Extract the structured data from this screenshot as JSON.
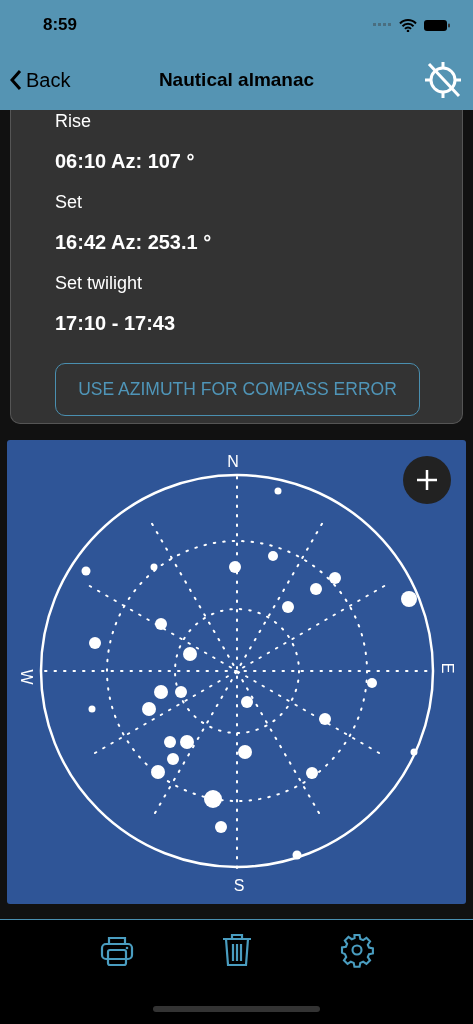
{
  "status_bar": {
    "time": "8:59"
  },
  "nav": {
    "back": "Back",
    "title": "Nautical almanac"
  },
  "events": [
    {
      "label": "Rise",
      "value": "06:10 Az: 107 °"
    },
    {
      "label": "Set",
      "value": "16:42 Az: 253.1 °"
    },
    {
      "label": "Set twilight",
      "value": "17:10 - 17:43"
    }
  ],
  "compass_button": "USE AZIMUTH FOR COMPASS ERROR",
  "sky_chart": {
    "directions": [
      {
        "kind": "north",
        "label": "N"
      },
      {
        "kind": "east",
        "label": "E"
      },
      {
        "kind": "south",
        "label": "S"
      },
      {
        "kind": "west",
        "label": "W"
      }
    ]
  }
}
